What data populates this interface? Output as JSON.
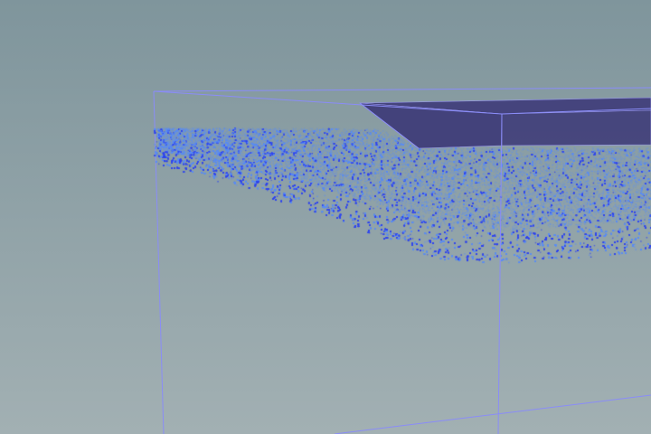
{
  "viewport": {
    "background_top": "#7f959c",
    "background_bottom": "#a2b0b3"
  },
  "simulation": {
    "fluid_color": "#2f44f0",
    "fluid_highlight": "#5a8cf5",
    "container_edge_color": "#8a8cf8",
    "collider_color": "#3f3d79",
    "collider_edge_color": "#9897f2"
  }
}
